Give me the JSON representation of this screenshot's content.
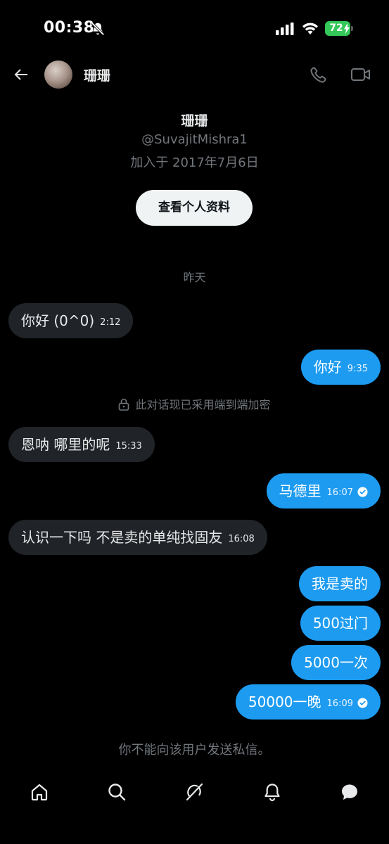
{
  "status_bar": {
    "time": "00:38",
    "battery": "72"
  },
  "header": {
    "name": "珊珊"
  },
  "profile": {
    "name": "珊珊",
    "handle": "@SuvajitMishra1",
    "joined": "加入于 2017年7月6日",
    "view_profile_label": "查看个人资料"
  },
  "date_divider": "昨天",
  "encryption_note": "此对话现已采用端到端加密",
  "messages": [
    {
      "text": "你好 (0^0)",
      "time": "2:12",
      "direction": "in"
    },
    {
      "text": "你好",
      "time": "9:35",
      "direction": "out"
    },
    {
      "text": "恩呐 哪里的呢",
      "time": "15:33",
      "direction": "in"
    },
    {
      "text": "马德里",
      "time": "16:07",
      "direction": "out",
      "read": true
    },
    {
      "text": "认识一下吗 不是卖的单纯找固友",
      "time": "16:08",
      "direction": "in"
    },
    {
      "text": "我是卖的",
      "time": "",
      "direction": "out"
    },
    {
      "text": "500过门",
      "time": "",
      "direction": "out"
    },
    {
      "text": "5000一次",
      "time": "",
      "direction": "out"
    },
    {
      "text": "50000一晚",
      "time": "16:09",
      "direction": "out",
      "read": true
    }
  ],
  "footer_notice": "你不能向该用户发送私信。",
  "colors": {
    "background": "#000000",
    "outgoing_bubble": "#1d9bf0",
    "incoming_bubble": "#202327",
    "secondary_text": "#71767b",
    "battery": "#34c759"
  },
  "bottom_nav": [
    "home-icon",
    "search-icon",
    "grok-icon",
    "notifications-icon",
    "messages-icon"
  ]
}
